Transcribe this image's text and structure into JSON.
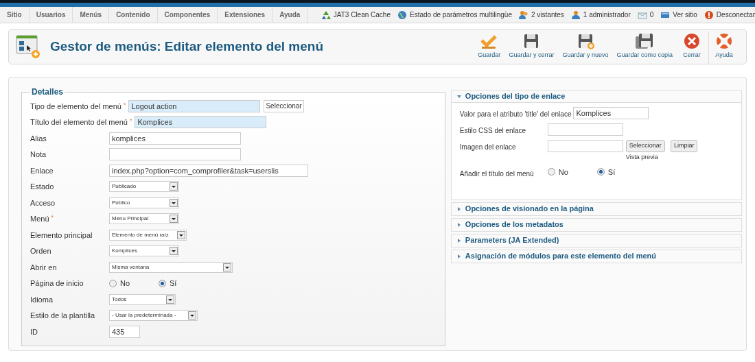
{
  "menu_bar": {
    "items": [
      {
        "label": "Sitio"
      },
      {
        "label": "Usuarios"
      },
      {
        "label": "Menús"
      },
      {
        "label": "Contenido"
      },
      {
        "label": "Componentes"
      },
      {
        "label": "Extensiones"
      },
      {
        "label": "Ayuda"
      }
    ],
    "status": [
      {
        "label": "JAT3 Clean Cache"
      },
      {
        "label": "Estado de parámetros multilingüe"
      },
      {
        "label": "2 vistantes"
      },
      {
        "label": "1 administrador"
      },
      {
        "label": "0"
      },
      {
        "label": "Ver sitio"
      },
      {
        "label": "Desconectar"
      }
    ]
  },
  "page_title": "Gestor de menús: Editar elemento del menú",
  "toolbar": [
    {
      "label": "Guardar"
    },
    {
      "label": "Guardar y cerrar"
    },
    {
      "label": "Guardar y nuevo"
    },
    {
      "label": "Guardar como copia"
    },
    {
      "label": "Cerrar"
    },
    {
      "label": "Ayuda"
    }
  ],
  "details": {
    "legend": "Detalles",
    "fields": [
      {
        "kind": "text",
        "label": "Tipo de elemento del menú",
        "required_mark": "*",
        "value": "Logout action",
        "highlighted": true,
        "button": "Seleccionar"
      },
      {
        "kind": "text",
        "label": "Título del elemento del menú",
        "required_mark": "*",
        "value": "Komplices",
        "highlighted": true
      },
      {
        "kind": "text",
        "label": "Alias",
        "value": "komplices",
        "highlighted": false
      },
      {
        "kind": "text",
        "label": "Nota",
        "highlighted": false
      },
      {
        "kind": "text",
        "label": "Enlace",
        "value": "index.php?option=com_comprofiler&task=userslis",
        "highlighted": false
      },
      {
        "kind": "select",
        "label": "Estado",
        "value": "Publicado"
      },
      {
        "kind": "select",
        "label": "Acceso",
        "value": "Público"
      },
      {
        "kind": "select",
        "label": "Menú",
        "required_mark": "*",
        "value": "Menu Principal"
      },
      {
        "kind": "select",
        "label": "Elemento principal",
        "value": "Elemento de menú raíz"
      },
      {
        "kind": "select",
        "label": "Orden",
        "value": "Komplices"
      },
      {
        "kind": "select",
        "label": "Abrir en",
        "value": "Misma ventana"
      },
      {
        "kind": "radio",
        "label": "Página de inicio",
        "options": [
          {
            "label": "No",
            "selected": false
          },
          {
            "label": "Sí",
            "selected": true
          }
        ]
      },
      {
        "kind": "select",
        "label": "Idioma",
        "value": "Todos"
      },
      {
        "kind": "select",
        "label": "Estilo de la plantilla",
        "value": "- Usar la predeterminada -"
      },
      {
        "kind": "text",
        "label": "ID",
        "value": "435",
        "highlighted": false
      }
    ]
  },
  "panels": [
    {
      "title": "Opciones del tipo de enlace",
      "expanded": true,
      "fields": [
        {
          "kind": "text",
          "label": "Valor para el atributo 'title' del enlace",
          "value": "Komplices"
        },
        {
          "kind": "text",
          "label": "Estilo CSS del enlace"
        },
        {
          "kind": "image",
          "label": "Imagen del enlace",
          "buttons": [
            "Seleccionar",
            "Limpiar"
          ],
          "note": "Vista previa"
        },
        {
          "kind": "radio",
          "label": "Añadir el título del menú",
          "options": [
            {
              "label": "No",
              "selected": false
            },
            {
              "label": "Sí",
              "selected": true
            }
          ]
        }
      ]
    },
    {
      "title": "Opciones de visionado en la página",
      "expanded": false
    },
    {
      "title": "Opciones de los metadatos",
      "expanded": false
    },
    {
      "title": "Parameters (JA Extended)",
      "expanded": false
    },
    {
      "title": "Asignación de módulos para este elemento del menú",
      "expanded": false
    }
  ]
}
